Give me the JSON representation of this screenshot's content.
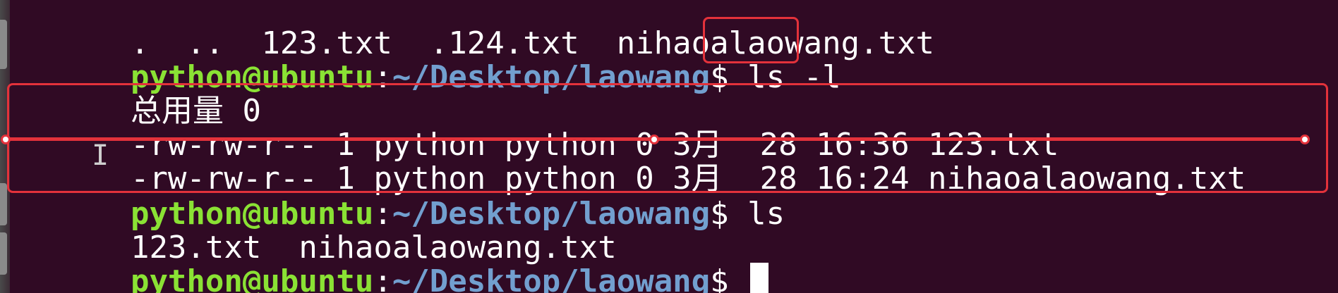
{
  "terminal": {
    "line0": ".  ..  123.txt  .124.txt  nihaoalaowang.txt",
    "prompt": {
      "user_host": "python@ubuntu",
      "colon": ":",
      "path": "~/Desktop/laowang",
      "dollar": "$"
    },
    "line1_cmd": " ls -l",
    "line2": "总用量 0",
    "line3": "-rw-rw-r-- 1 python python 0 3月  28 16:36 123.txt",
    "line4": "-rw-rw-r-- 1 python python 0 3月  28 16:24 nihaoalaowang.txt",
    "line5_cmd": " ls",
    "line6": "123.txt  nihaoalaowang.txt",
    "line7_cmd": " "
  },
  "annotation_color": "#e3323b"
}
